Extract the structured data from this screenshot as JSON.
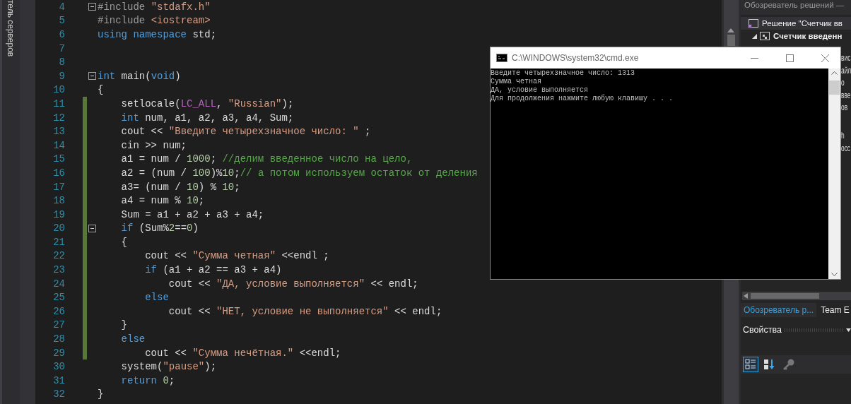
{
  "left_strip": {
    "label": "тель серверов"
  },
  "code": {
    "lines": [
      {
        "number": "4",
        "changed": false,
        "fold": true,
        "tokens": [
          {
            "text": "#include ",
            "kind": "directive"
          },
          {
            "text": "\"stdafx.h\"",
            "kind": "string"
          }
        ]
      },
      {
        "number": "5",
        "changed": false,
        "fold": false,
        "tokens": [
          {
            "text": "#include ",
            "kind": "directive"
          },
          {
            "text": "<iostream>",
            "kind": "string"
          }
        ]
      },
      {
        "number": "6",
        "changed": false,
        "fold": false,
        "tokens": [
          {
            "text": "using namespace",
            "kind": "keyword"
          },
          {
            "text": " std;",
            "kind": "plain"
          }
        ]
      },
      {
        "number": "7",
        "changed": false,
        "fold": false
      },
      {
        "number": "8",
        "changed": false,
        "fold": false
      },
      {
        "number": "9",
        "changed": false,
        "fold": true,
        "tokens": [
          {
            "text": "int",
            "kind": "keyword"
          },
          {
            "text": " main(",
            "kind": "plain"
          },
          {
            "text": "void",
            "kind": "keyword"
          },
          {
            "text": ")",
            "kind": "plain"
          }
        ]
      },
      {
        "number": "10",
        "changed": false,
        "fold": false,
        "tokens": [
          {
            "text": "{",
            "kind": "plain"
          }
        ]
      },
      {
        "number": "11",
        "changed": true,
        "fold": false,
        "tokens": [
          {
            "text": "    setlocale(",
            "kind": "plain"
          },
          {
            "text": "LC_ALL",
            "kind": "macro"
          },
          {
            "text": ", ",
            "kind": "plain"
          },
          {
            "text": "\"Russian\"",
            "kind": "string"
          },
          {
            "text": ");",
            "kind": "plain"
          }
        ]
      },
      {
        "number": "12",
        "changed": true,
        "fold": false,
        "tokens": [
          {
            "text": "    int",
            "kind": "keyword"
          },
          {
            "text": " num, a1, a2, a3, a4, Sum;",
            "kind": "plain"
          }
        ]
      },
      {
        "number": "13",
        "changed": true,
        "fold": false,
        "tokens": [
          {
            "text": "    cout << ",
            "kind": "plain"
          },
          {
            "text": "\"Введите четырехзначное число: \"",
            "kind": "string"
          },
          {
            "text": " ;",
            "kind": "plain"
          }
        ]
      },
      {
        "number": "14",
        "changed": true,
        "fold": false,
        "tokens": [
          {
            "text": "    cin >> num;",
            "kind": "plain"
          }
        ]
      },
      {
        "number": "15",
        "changed": true,
        "fold": false,
        "tokens": [
          {
            "text": "    a1 = num / ",
            "kind": "plain"
          },
          {
            "text": "1000",
            "kind": "number"
          },
          {
            "text": "; ",
            "kind": "plain"
          },
          {
            "text": "//делим введенное число на цело,",
            "kind": "comment"
          }
        ]
      },
      {
        "number": "16",
        "changed": true,
        "fold": false,
        "tokens": [
          {
            "text": "    a2 = (num / ",
            "kind": "plain"
          },
          {
            "text": "100",
            "kind": "number"
          },
          {
            "text": ")%",
            "kind": "plain"
          },
          {
            "text": "10",
            "kind": "number"
          },
          {
            "text": ";",
            "kind": "plain"
          },
          {
            "text": "// а потом используем остаток от деления",
            "kind": "comment"
          }
        ]
      },
      {
        "number": "17",
        "changed": true,
        "fold": false,
        "tokens": [
          {
            "text": "    a3= (num / ",
            "kind": "plain"
          },
          {
            "text": "10",
            "kind": "number"
          },
          {
            "text": ") % ",
            "kind": "plain"
          },
          {
            "text": "10",
            "kind": "number"
          },
          {
            "text": ";",
            "kind": "plain"
          }
        ]
      },
      {
        "number": "18",
        "changed": true,
        "fold": false,
        "tokens": [
          {
            "text": "    a4 = num % ",
            "kind": "plain"
          },
          {
            "text": "10",
            "kind": "number"
          },
          {
            "text": ";",
            "kind": "plain"
          }
        ]
      },
      {
        "number": "19",
        "changed": true,
        "fold": false,
        "tokens": [
          {
            "text": "    Sum = a1 + a2 + a3 + a4;",
            "kind": "plain"
          }
        ]
      },
      {
        "number": "20",
        "changed": true,
        "fold": true,
        "tokens": [
          {
            "text": "    if",
            "kind": "keyword"
          },
          {
            "text": " (Sum%",
            "kind": "plain"
          },
          {
            "text": "2",
            "kind": "number"
          },
          {
            "text": "==",
            "kind": "plain"
          },
          {
            "text": "0",
            "kind": "number"
          },
          {
            "text": ")",
            "kind": "plain"
          }
        ]
      },
      {
        "number": "21",
        "changed": true,
        "fold": false,
        "tokens": [
          {
            "text": "    {",
            "kind": "plain"
          }
        ]
      },
      {
        "number": "22",
        "changed": true,
        "fold": false,
        "tokens": [
          {
            "text": "        cout << ",
            "kind": "plain"
          },
          {
            "text": "\"Сумма четная\"",
            "kind": "string"
          },
          {
            "text": " <<endl ;",
            "kind": "plain"
          }
        ]
      },
      {
        "number": "23",
        "changed": true,
        "fold": false,
        "tokens": [
          {
            "text": "        if",
            "kind": "keyword"
          },
          {
            "text": " (a1 + a2 == a3 + a4)",
            "kind": "plain"
          }
        ]
      },
      {
        "number": "24",
        "changed": true,
        "fold": false,
        "tokens": [
          {
            "text": "            cout << ",
            "kind": "plain"
          },
          {
            "text": "\"ДА, условие выполняется\"",
            "kind": "string"
          },
          {
            "text": " << endl;",
            "kind": "plain"
          }
        ]
      },
      {
        "number": "25",
        "changed": true,
        "fold": false,
        "tokens": [
          {
            "text": "        else",
            "kind": "keyword"
          }
        ]
      },
      {
        "number": "26",
        "changed": true,
        "fold": false,
        "tokens": [
          {
            "text": "            cout << ",
            "kind": "plain"
          },
          {
            "text": "\"НЕТ, условие не выполняется\"",
            "kind": "string"
          },
          {
            "text": " << endl;",
            "kind": "plain"
          }
        ]
      },
      {
        "number": "27",
        "changed": true,
        "fold": false,
        "tokens": [
          {
            "text": "    }",
            "kind": "plain"
          }
        ]
      },
      {
        "number": "28",
        "changed": true,
        "fold": false,
        "tokens": [
          {
            "text": "    else",
            "kind": "keyword"
          }
        ]
      },
      {
        "number": "29",
        "changed": true,
        "fold": false,
        "tokens": [
          {
            "text": "        cout << ",
            "kind": "plain"
          },
          {
            "text": "\"Сумма нечётная.\"",
            "kind": "string"
          },
          {
            "text": " <<endl;",
            "kind": "plain"
          }
        ]
      },
      {
        "number": "30",
        "changed": false,
        "fold": false,
        "tokens": [
          {
            "text": "    system(",
            "kind": "plain"
          },
          {
            "text": "\"pause\"",
            "kind": "string"
          },
          {
            "text": ");",
            "kind": "plain"
          }
        ]
      },
      {
        "number": "31",
        "changed": false,
        "fold": false,
        "tokens": [
          {
            "text": "    return ",
            "kind": "keyword"
          },
          {
            "text": "0",
            "kind": "number"
          },
          {
            "text": ";",
            "kind": "plain"
          }
        ]
      },
      {
        "number": "32",
        "changed": false,
        "fold": false,
        "tokens": [
          {
            "text": "}",
            "kind": "plain"
          }
        ]
      }
    ]
  },
  "console": {
    "title": "C:\\WINDOWS\\system32\\cmd.exe",
    "lines": [
      "Введите четырехзначное число: 1313",
      "Сумма четная",
      "ДА, условие выполняется",
      "Для продолжения нажмите любую клавишу . . ."
    ]
  },
  "solution_explorer": {
    "title": "Обозреватель решений —",
    "tree": [
      {
        "text": "Решение \"Счетчик вв",
        "children": [
          {
            "text": "Счетчик введенн",
            "expanded": true
          }
        ]
      }
    ],
    "hidden_item_fragments": [
      "вис",
      "айл",
      "о",
      "вве",
      "ов",
      "h",
      "осс"
    ]
  },
  "panel_tabs": [
    {
      "label": "Обозреватель р...",
      "selected": true
    },
    {
      "label": "Team E",
      "selected": false
    }
  ],
  "properties": {
    "title": "Свойства",
    "toolbar": [
      {
        "kind": "categorized",
        "selected": true
      },
      {
        "kind": "alphabetical",
        "selected": false
      },
      {
        "kind": "property-pages",
        "selected": false
      }
    ]
  }
}
